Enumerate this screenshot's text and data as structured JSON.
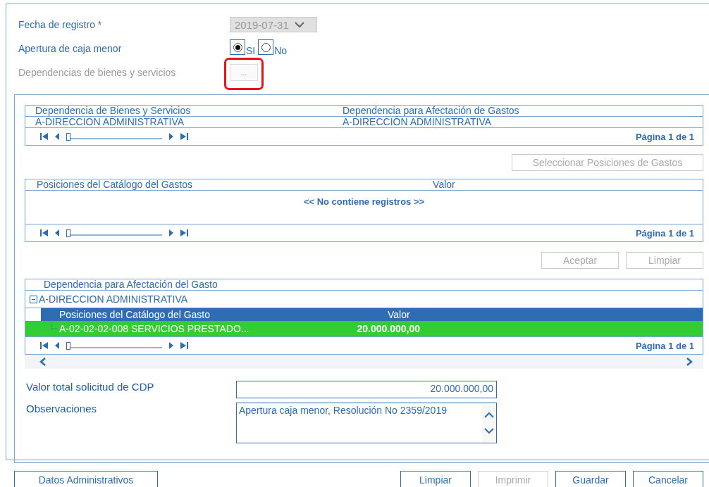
{
  "fecha": {
    "label": "Fecha de registro *",
    "value": "2019-07-31",
    "disabled": true
  },
  "apertura": {
    "label": "Apertura de caja menor",
    "options": [
      {
        "label": "SI",
        "selected": true
      },
      {
        "label": "No",
        "selected": false
      }
    ]
  },
  "dependencias": {
    "label": "Dependencias de bienes y servicios",
    "button": "...",
    "disabled": true,
    "highlighted": true
  },
  "grid1": {
    "columns": [
      "Dependencia de Bienes y Servicios",
      "Dependencia para Afectación de Gastos"
    ],
    "rows": [
      [
        "A-DIRECCION ADMINISTRATIVA",
        "A-DIRECCIÓN ADMINISTRATIVA"
      ]
    ],
    "pager": {
      "label": "Página 1 de 1",
      "level": 0
    }
  },
  "select_button": {
    "label": "Seleccionar Posiciones de Gastos",
    "disabled": true
  },
  "grid2": {
    "columns": [
      "Posiciones del Catálogo del Gastos",
      "Valor"
    ],
    "empty": "<< No contiene registros >>",
    "pager": {
      "label": "Página 1 de 1",
      "level": 0
    }
  },
  "grid_buttons": [
    {
      "label": "Aceptar",
      "disabled": true
    },
    {
      "label": "Limpiar",
      "disabled": true
    }
  ],
  "tree_grid": {
    "column": "Dependencia para Afectación del Gasto",
    "groups": [
      {
        "label": "A-DIRECCION ADMINISTRATIVA",
        "expanded": true,
        "columns": [
          "Posiciones del Catálogo del Gasto",
          "Valor"
        ],
        "rows": [
          {
            "cells": [
              "A-02-02-02-008 SERVICIOS PRESTADO...",
              "20.000.000,00"
            ],
            "selected": true
          }
        ]
      }
    ],
    "pager": {
      "label": "Página 1 de 1",
      "level": 0
    }
  },
  "total": {
    "label": "Valor total solicitud de CDP",
    "value": "20.000.000,00"
  },
  "observaciones": {
    "label": "Observaciones",
    "value": "Apertura caja menor, Resolución No 2359/2019"
  },
  "footer_left": {
    "label": "Datos Administrativos",
    "disabled": false
  },
  "footer_buttons": [
    {
      "label": "Limpiar",
      "disabled": false
    },
    {
      "label": "Imprimir",
      "disabled": true
    },
    {
      "label": "Guardar",
      "disabled": false
    },
    {
      "label": "Cancelar",
      "disabled": false
    }
  ]
}
